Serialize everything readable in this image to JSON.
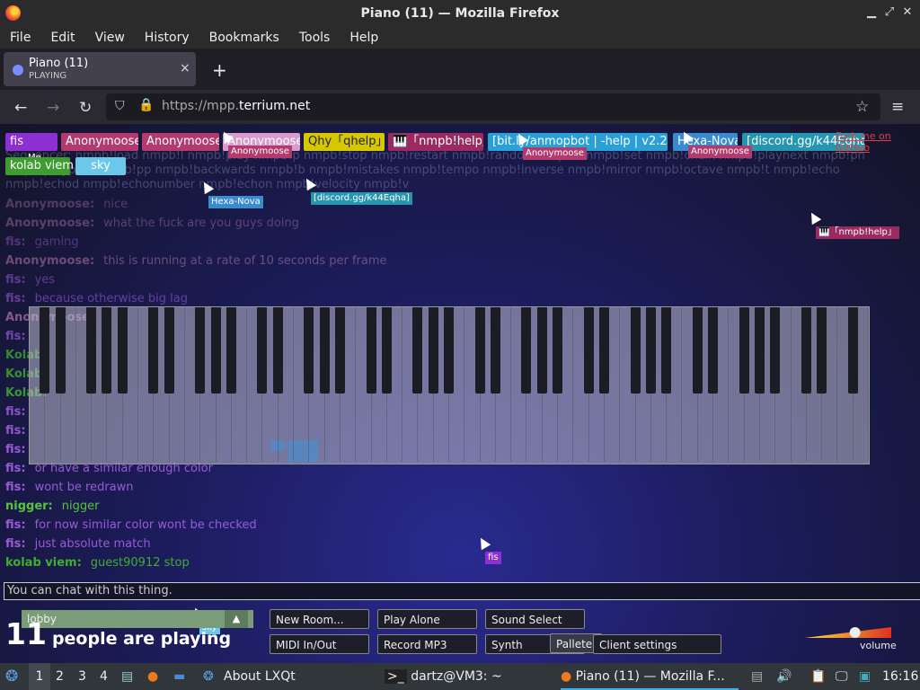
{
  "window": {
    "title": "Piano (11) — Mozilla Firefox"
  },
  "menubar": [
    "File",
    "Edit",
    "View",
    "History",
    "Bookmarks",
    "Tools",
    "Help"
  ],
  "tab": {
    "title": "Piano (11)",
    "subtitle": "PLAYING",
    "close": "×",
    "new_tab": "+"
  },
  "nav": {
    "back": "←",
    "forward": "→",
    "reload": "↻",
    "url_prefix": "https://mpp.",
    "url_domain": "terrium.net"
  },
  "users_row1": [
    {
      "name": "fis",
      "color": "#8e2fd4",
      "sub": "Me"
    },
    {
      "name": "Anonymoose",
      "color": "#b23a6e"
    },
    {
      "name": "Anonymoose",
      "color": "#b23a6e"
    },
    {
      "name": "Anonymoose",
      "color": "#d99bcc"
    },
    {
      "name": "Qhy「qhelp」",
      "color": "#d6c800"
    },
    {
      "name": "🎹「nmpb!help」",
      "color": "#9a2a60"
    },
    {
      "name": "[bit.ly/anmopbot | -help | v2.2A]",
      "color": "#2aa0d8"
    },
    {
      "name": "Hexa-Nova",
      "color": "#3a8ad0"
    },
    {
      "name": "[discord.gg/k44Eqha]",
      "color": "#2496b0"
    }
  ],
  "users_row2": [
    {
      "name": "kolab viem",
      "color": "#3f9d2f"
    },
    {
      "name": "sky",
      "color": "#6cc8ea"
    }
  ],
  "fork_link": "Fork me on GitHub",
  "cursors": [
    {
      "name": "Anonymoose",
      "color": "#b23a6e"
    },
    {
      "name": "Anonymoose",
      "color": "#b23a6e"
    },
    {
      "name": "Anonymoose",
      "color": "#b23a6e"
    },
    {
      "name": "Hexa-Nova",
      "color": "#3a8ad0"
    },
    {
      "name": "[discord.gg/k44Eqha]",
      "color": "#2496b0"
    },
    {
      "name": "🎹「nmpb!help」",
      "color": "#9a2a60"
    },
    {
      "name": "fis",
      "color": "#8e2fd4"
    },
    {
      "name": "sky",
      "color": "#6cc8ea"
    }
  ],
  "sequencer_text": "Sequencer: nmpb!load nmpb!l nmpb!play nmpb!p nmpb!stop nmpb!restart nmpb!random nmpb!r nmpb!set nmpb!chain nmpb!playnext nmpb!pn nmpb!playprev nmpb!pp nmpb!backwards nmpb!b nmpb!mistakes nmpb!tempo nmpb!inverse nmpb!mirror nmpb!octave nmpb!t nmpb!echo nmpb!echod nmpb!echonumber nmpb!echon nmpb!velocity nmpb!v",
  "chat": [
    {
      "name": "Anonymoose:",
      "text": "nice",
      "color": "#c080b0"
    },
    {
      "name": "Anonymoose:",
      "text": "what the fuck are you guys doing",
      "color": "#c080b0"
    },
    {
      "name": "fis:",
      "text": "gaming",
      "color": "#9a5ad8"
    },
    {
      "name": "Anonymoose:",
      "text": "this is running at a rate of 10 seconds per frame",
      "color": "#c080b0"
    },
    {
      "name": "fis:",
      "text": "yes",
      "color": "#9a5ad8"
    },
    {
      "name": "fis:",
      "text": "because otherwise big lag",
      "color": "#9a5ad8"
    },
    {
      "name": "Anonymoose:",
      "text": "",
      "color": "#c080b0"
    },
    {
      "name": "fis:",
      "text": "",
      "color": "#9a5ad8"
    },
    {
      "name": "Kolab:",
      "text": "",
      "color": "#3fae2f"
    },
    {
      "name": "Kolab:",
      "text": "",
      "color": "#3fae2f"
    },
    {
      "name": "Kolab:",
      "text": "",
      "color": "#3fae2f"
    },
    {
      "name": "fis:",
      "text": "",
      "color": "#9a5ad8"
    },
    {
      "name": "fis:",
      "text": "",
      "color": "#9a5ad8"
    },
    {
      "name": "fis:",
      "text": "",
      "color": "#9a5ad8"
    },
    {
      "name": "fis:",
      "text": "or have a similar enough color",
      "color": "#9a5ad8"
    },
    {
      "name": "fis:",
      "text": "wont be redrawn",
      "color": "#9a5ad8"
    },
    {
      "name": "nigger:",
      "text": "nigger",
      "color": "#56c43c"
    },
    {
      "name": "fis:",
      "text": "for now similar color wont be checked",
      "color": "#9a5ad8"
    },
    {
      "name": "fis:",
      "text": "just absolute match",
      "color": "#9a5ad8"
    },
    {
      "name": "kolab viem:",
      "text": "guest90912 stop",
      "color": "#3fae2f"
    }
  ],
  "chat_input_placeholder": "You can chat with this thing.",
  "room": {
    "name": "lobby",
    "arrow": "▲"
  },
  "player_count": {
    "number": "11",
    "label": "people are playing"
  },
  "buttons": {
    "new_room": "New Room...",
    "play_alone": "Play Alone",
    "sound_select": "Sound Select",
    "midi": "MIDI In/Out",
    "record": "Record MP3",
    "synth": "Synth",
    "pallete": "Pallete",
    "client_settings": "Client settings"
  },
  "volume": {
    "label": "volume",
    "level": 0.58
  },
  "taskbar": {
    "workspaces": [
      "1",
      "2",
      "3",
      "4"
    ],
    "about": "About LXQt",
    "terminal": "dartz@VM3: ~",
    "firefox": "Piano (11) — Mozilla F...",
    "clock": "16:16"
  }
}
